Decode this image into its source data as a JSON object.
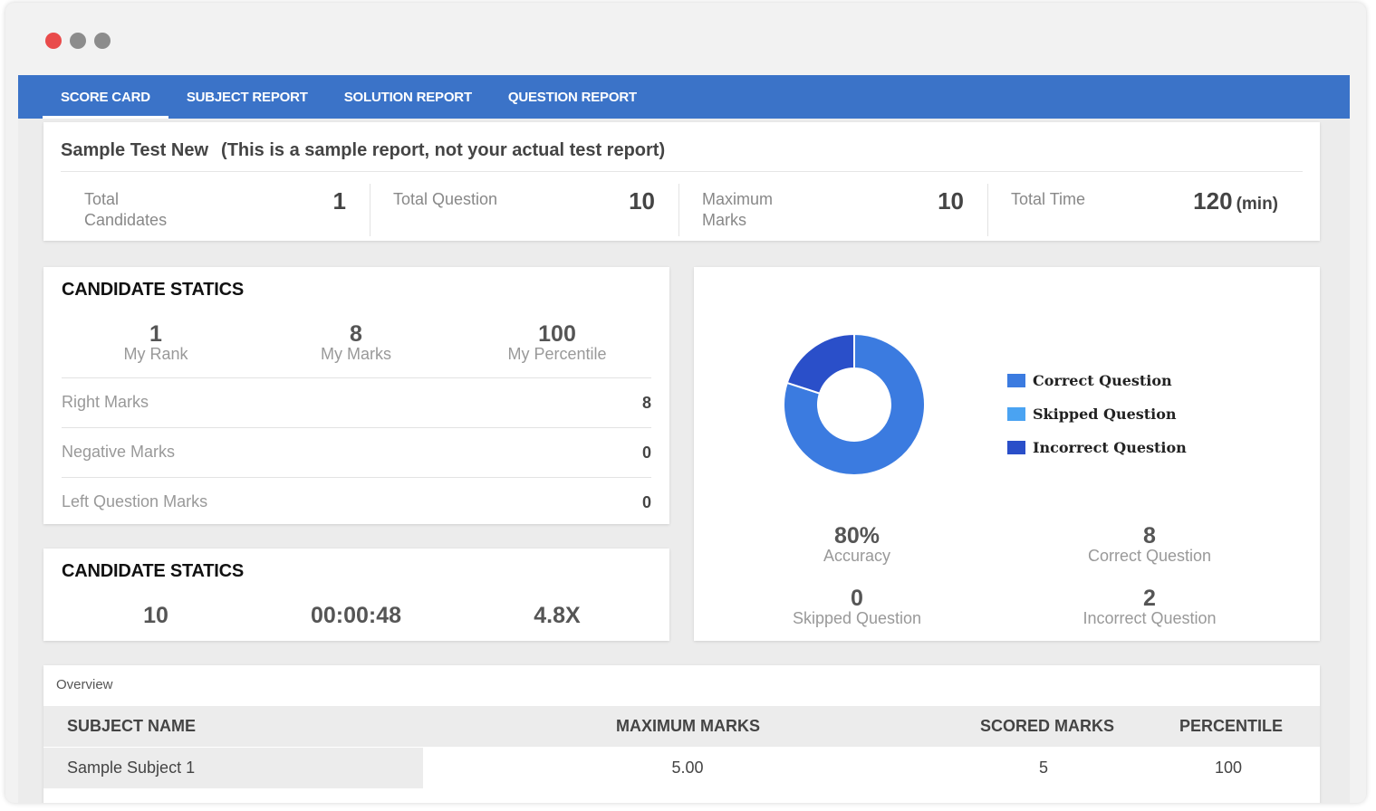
{
  "window": {
    "controls": [
      {
        "name": "close",
        "color": "#e94b4b"
      },
      {
        "name": "minimize",
        "color": "#8c8c8c"
      },
      {
        "name": "maximize",
        "color": "#8c8c8c"
      }
    ]
  },
  "tabs": [
    {
      "label": "SCORE CARD",
      "active": true
    },
    {
      "label": "SUBJECT REPORT",
      "active": false
    },
    {
      "label": "SOLUTION REPORT",
      "active": false
    },
    {
      "label": "QUESTION REPORT",
      "active": false
    }
  ],
  "header": {
    "test_name": "Sample Test New",
    "note": "(This is a sample report, not your actual test report)",
    "stats": [
      {
        "label": "Total Candidates",
        "value": "1",
        "unit": ""
      },
      {
        "label": "Total Question",
        "value": "10",
        "unit": ""
      },
      {
        "label": "Maximum Marks",
        "value": "10",
        "unit": ""
      },
      {
        "label": "Total Time",
        "value": "120",
        "unit": "(min)"
      }
    ]
  },
  "candidate_stats": {
    "title": "CANDIDATE STATICS",
    "summary": [
      {
        "value": "1",
        "label": "My Rank"
      },
      {
        "value": "8",
        "label": "My Marks"
      },
      {
        "value": "100",
        "label": "My Percentile"
      }
    ],
    "rows": [
      {
        "label": "Right Marks",
        "value": "8"
      },
      {
        "label": "Negative Marks",
        "value": "0"
      },
      {
        "label": "Left Question Marks",
        "value": "0"
      }
    ]
  },
  "candidate_stats_2": {
    "title": "CANDIDATE STATICS",
    "values": [
      "10",
      "00:00:48",
      "4.8X"
    ]
  },
  "chart_data": {
    "type": "pie",
    "categories": [
      "Correct Question",
      "Skipped Question",
      "Incorrect Question"
    ],
    "values": [
      8,
      0,
      2
    ],
    "colors": [
      "#3b7be0",
      "#4aa3f2",
      "#2a4fc9"
    ],
    "legend": "right"
  },
  "accuracy_stats": [
    {
      "value": "80%",
      "label": "Accuracy"
    },
    {
      "value": "8",
      "label": "Correct Question"
    },
    {
      "value": "0",
      "label": "Skipped Question"
    },
    {
      "value": "2",
      "label": "Incorrect Question"
    }
  ],
  "overview": {
    "title": "Overview",
    "columns": [
      "SUBJECT NAME",
      "MAXIMUM MARKS",
      "SCORED MARKS",
      "PERCENTILE"
    ],
    "rows": [
      [
        "Sample Subject 1",
        "5.00",
        "5",
        "100"
      ]
    ]
  },
  "colors": {
    "accent": "#3b73c8"
  }
}
